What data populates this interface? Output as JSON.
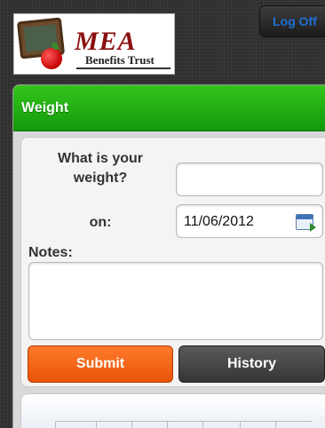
{
  "header": {
    "logo_title": "MEA",
    "logo_subtitle": "Benefits Trust",
    "logoff_label": "Log Off"
  },
  "panel": {
    "title": "Weight"
  },
  "form": {
    "weight_question": "What is your weight?",
    "weight_value": "",
    "date_label": "on:",
    "date_value": "11/06/2012",
    "notes_label": "Notes:",
    "notes_value": "",
    "submit_label": "Submit",
    "history_label": "History"
  },
  "colors": {
    "header_green": "#1fad12",
    "submit_orange": "#f26517",
    "history_gray": "#454545",
    "logoff_text": "#1f6fd6"
  }
}
